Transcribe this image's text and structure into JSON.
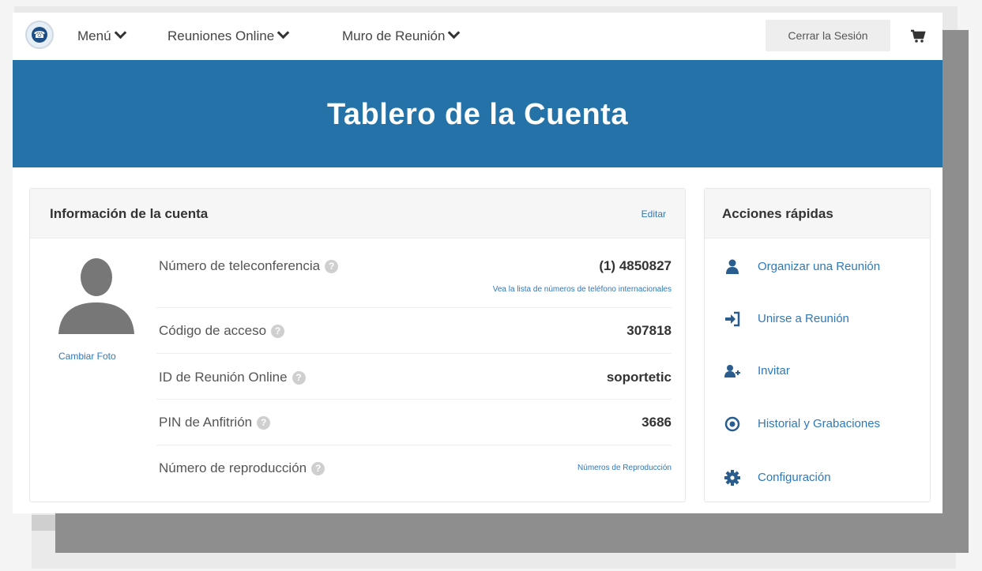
{
  "nav": {
    "menu": "Menú",
    "online_meetings": "Reuniones Online",
    "meeting_wall": "Muro de Reunión",
    "logout": "Cerrar la Sesión"
  },
  "banner": {
    "title": "Tablero de la Cuenta"
  },
  "account": {
    "title": "Información de la cuenta",
    "edit": "Editar",
    "change_photo": "Cambiar Foto",
    "rows": [
      {
        "label": "Número de teleconferencia",
        "value": "(1) 4850827",
        "link": "Vea la lista de números de teléfono internacionales"
      },
      {
        "label": "Código de acceso",
        "value": "307818"
      },
      {
        "label": "ID de Reunión Online",
        "value": "soportetic"
      },
      {
        "label": "PIN de Anfitrión",
        "value": "3686"
      },
      {
        "label": "Número de reproducción",
        "link": "Números de Reproducción"
      }
    ]
  },
  "quick_actions": {
    "title": "Acciones rápidas",
    "items": [
      {
        "label": "Organizar una Reunión",
        "icon": "user-icon"
      },
      {
        "label": "Unirse a Reunión",
        "icon": "sign-in-icon"
      },
      {
        "label": "Invitar",
        "icon": "user-plus-icon"
      },
      {
        "label": "Historial y Grabaciones",
        "icon": "record-icon"
      },
      {
        "label": "Configuración",
        "icon": "gear-icon"
      }
    ]
  },
  "colors": {
    "banner": "#2572a8",
    "link": "#2f78b8",
    "icon": "#2a5d8e"
  }
}
